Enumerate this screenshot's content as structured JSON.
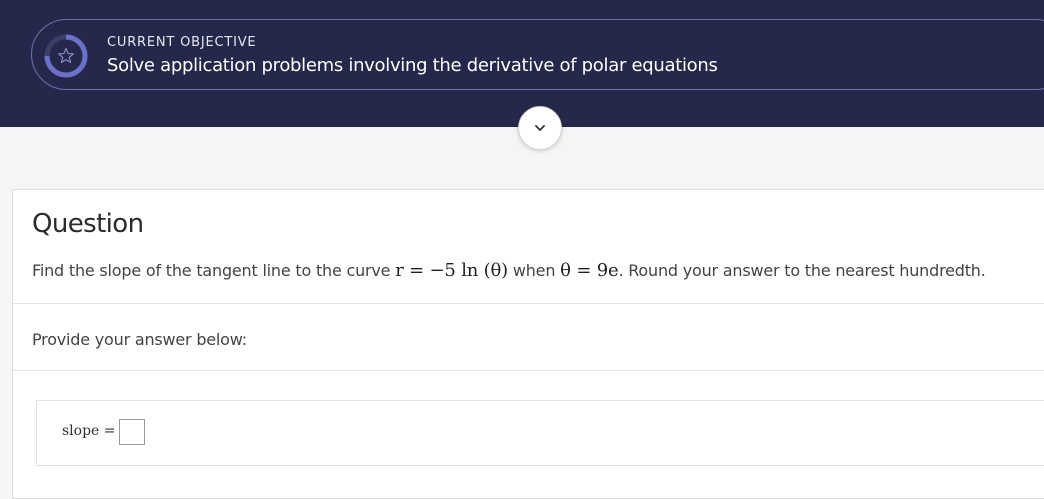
{
  "header": {
    "kicker": "CURRENT OBJECTIVE",
    "objective": "Solve application problems involving the derivative of polar equations",
    "progress_fraction": 0.75,
    "ring_color": "#6b70c9",
    "icon": "star-icon"
  },
  "toggle": {
    "icon": "chevron-down-icon"
  },
  "question": {
    "heading": "Question",
    "prefix": "Find the slope of the tangent line to the curve ",
    "equation": "r = −5 ln (θ)",
    "middle": " when ",
    "condition": "θ = 9e",
    "suffix": ". Round your answer to the nearest hundredth."
  },
  "answer": {
    "prompt": "Provide your answer below:",
    "label": "slope =",
    "value": ""
  }
}
